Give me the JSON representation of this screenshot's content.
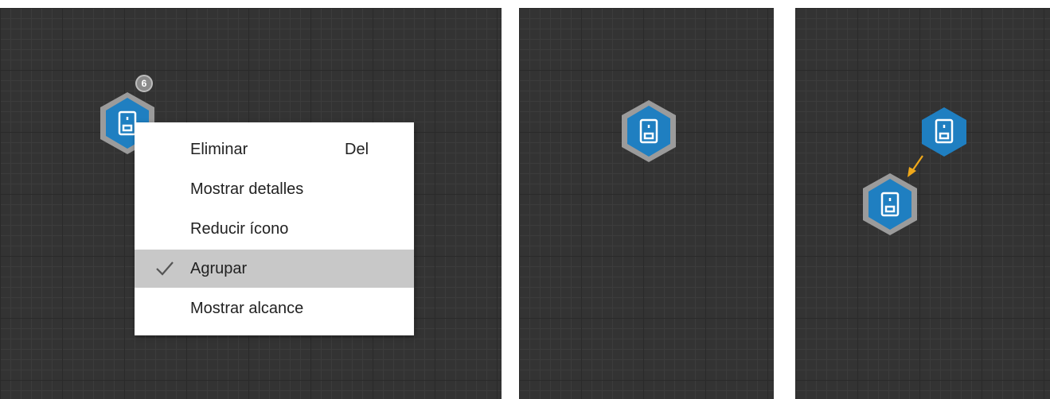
{
  "panel_1": {
    "group_node": {
      "icon": "speaker-device-icon",
      "badge_count": "6"
    },
    "context_menu": {
      "items": [
        {
          "label": "Eliminar",
          "shortcut": "Del",
          "checked": false
        },
        {
          "label": "Mostrar detalles",
          "shortcut": "",
          "checked": false
        },
        {
          "label": "Reducir ícono",
          "shortcut": "",
          "checked": false
        },
        {
          "label": "Agrupar",
          "shortcut": "",
          "checked": true
        },
        {
          "label": "Mostrar alcance",
          "shortcut": "",
          "checked": false
        }
      ]
    }
  },
  "panel_2": {
    "node": {
      "icon": "speaker-device-icon"
    }
  },
  "panel_3": {
    "nodes": [
      {
        "icon": "speaker-device-icon",
        "style": "small-no-border"
      },
      {
        "icon": "speaker-device-icon",
        "style": "bordered"
      }
    ],
    "link_arrow": {
      "icon": "arrow-down-left-icon"
    }
  },
  "colors": {
    "canvas": "#333333",
    "grid": "#2a2a2a",
    "node_fill": "#1f7fc1",
    "node_border": "#9b9b9b",
    "menu_bg": "#ffffff",
    "menu_selected": "#c8c8c8",
    "arrow": "#f0a81a"
  }
}
